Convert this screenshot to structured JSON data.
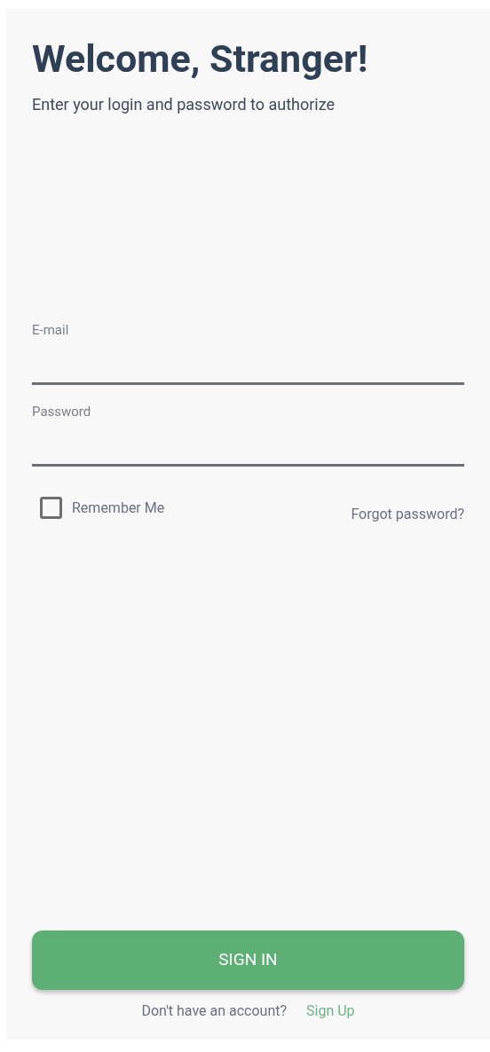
{
  "title": "Welcome, Stranger!",
  "subtitle": "Enter your login and password to authorize",
  "fields": [
    {
      "label": "E-mail"
    },
    {
      "label": "Password"
    }
  ],
  "remember": {
    "label": "Remember Me",
    "checked": false
  },
  "forgot_link": "Forgot password?",
  "submit_button": "SIGN IN",
  "signup": {
    "prompt": "Don't have an account?",
    "link": "Sign Up"
  }
}
